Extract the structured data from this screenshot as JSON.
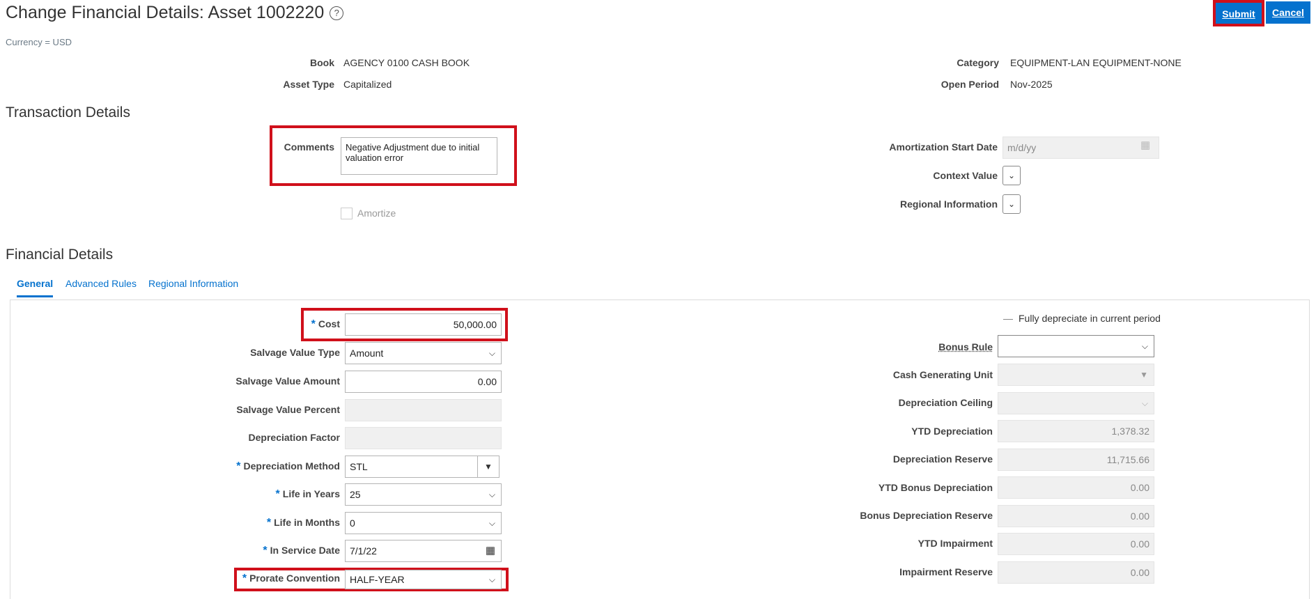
{
  "header": {
    "title": "Change Financial Details: Asset 1002220",
    "help_icon": "help-circle-icon",
    "currency": "Currency = USD",
    "submit_label": "Submit",
    "cancel_label": "Cancel"
  },
  "asset_info": {
    "book_label": "Book",
    "book_value": "AGENCY 0100 CASH BOOK",
    "asset_type_label": "Asset Type",
    "asset_type_value": "Capitalized",
    "category_label": "Category",
    "category_value": "EQUIPMENT-LAN EQUIPMENT-NONE",
    "open_period_label": "Open Period",
    "open_period_value": "Nov-2025"
  },
  "transaction_details": {
    "section_title": "Transaction Details",
    "comments_label": "Comments",
    "comments_value": "Negative Adjustment due to initial valuation error",
    "amortize_label": "Amortize",
    "amortization_start_label": "Amortization Start Date",
    "amortization_start_placeholder": "m/d/yy",
    "context_value_label": "Context Value",
    "regional_info_label": "Regional Information"
  },
  "financial_details": {
    "section_title": "Financial Details",
    "tabs": [
      {
        "label": "General"
      },
      {
        "label": "Advanced Rules"
      },
      {
        "label": "Regional Information"
      }
    ],
    "cost_label": "Cost",
    "cost_value": "50,000.00",
    "salvage_type_label": "Salvage Value Type",
    "salvage_type_value": "Amount",
    "salvage_amount_label": "Salvage Value Amount",
    "salvage_amount_value": "0.00",
    "salvage_percent_label": "Salvage Value Percent",
    "dep_factor_label": "Depreciation Factor",
    "dep_method_label": "Depreciation Method",
    "dep_method_value": "STL",
    "life_years_label": "Life in Years",
    "life_years_value": "25",
    "life_months_label": "Life in Months",
    "life_months_value": "0",
    "in_service_label": "In Service Date",
    "in_service_value": "7/1/22",
    "prorate_label": "Prorate Convention",
    "prorate_value": "HALF-YEAR",
    "fully_depreciate_label": "Fully depreciate in current period",
    "bonus_rule_label": "Bonus Rule",
    "cgu_label": "Cash Generating Unit",
    "dep_ceiling_label": "Depreciation Ceiling",
    "ytd_dep_label": "YTD Depreciation",
    "ytd_dep_value": "1,378.32",
    "dep_reserve_label": "Depreciation Reserve",
    "dep_reserve_value": "11,715.66",
    "ytd_bonus_label": "YTD Bonus Depreciation",
    "ytd_bonus_value": "0.00",
    "bonus_reserve_label": "Bonus Depreciation Reserve",
    "bonus_reserve_value": "0.00",
    "ytd_impair_label": "YTD Impairment",
    "ytd_impair_value": "0.00",
    "impair_reserve_label": "Impairment Reserve",
    "impair_reserve_value": "0.00"
  },
  "colors": {
    "accent": "#0572ce",
    "highlight": "#d0101b"
  }
}
